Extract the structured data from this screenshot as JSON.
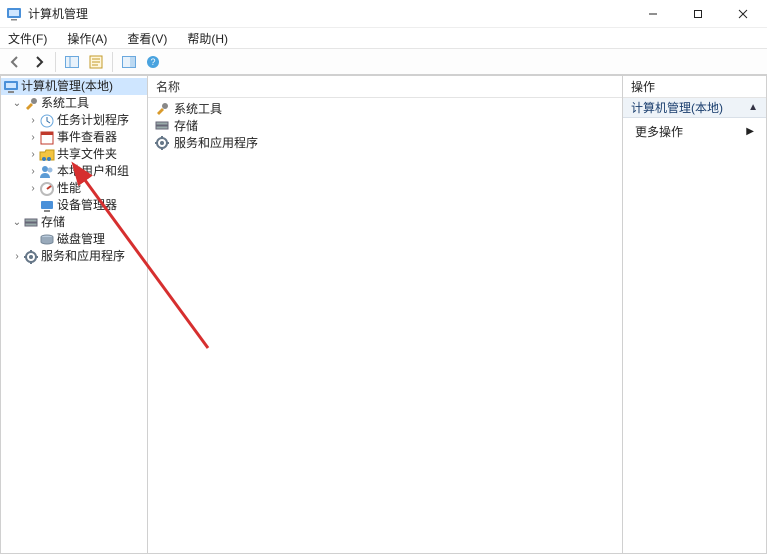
{
  "window": {
    "title": "计算机管理"
  },
  "menu": {
    "file": "文件(F)",
    "action": "操作(A)",
    "view": "查看(V)",
    "help": "帮助(H)"
  },
  "tree": {
    "root": "计算机管理(本地)",
    "system_tools": "系统工具",
    "task_scheduler": "任务计划程序",
    "event_viewer": "事件查看器",
    "shared_folders": "共享文件夹",
    "local_users": "本地用户和组",
    "performance": "性能",
    "device_manager": "设备管理器",
    "storage": "存储",
    "disk_management": "磁盘管理",
    "services_apps": "服务和应用程序"
  },
  "center": {
    "column_name": "名称",
    "items": {
      "system_tools": "系统工具",
      "storage": "存储",
      "services_apps": "服务和应用程序"
    }
  },
  "actions": {
    "header": "操作",
    "context": "计算机管理(本地)",
    "more": "更多操作"
  }
}
